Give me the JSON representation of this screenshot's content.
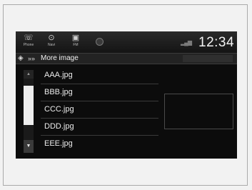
{
  "status_bar": {
    "icons": [
      {
        "icon": "phone-icon",
        "caption": "Phone"
      },
      {
        "icon": "navigation-icon",
        "caption": "Navi"
      },
      {
        "icon": "audio-icon",
        "caption": "FM"
      },
      {
        "icon": "home-icon",
        "caption": ""
      }
    ],
    "clock": "12:34"
  },
  "title_bar": {
    "icon": "media-icon",
    "chevrons": "»»",
    "title": "More image"
  },
  "file_list": {
    "items": [
      "AAA.jpg",
      "BBB.jpg",
      "CCC.jpg",
      "DDD.jpg",
      "EEE.jpg"
    ]
  },
  "colors": {
    "screen_bg": "#0c0c0c",
    "scroll_thumb": "#ededed",
    "text": "#ececec"
  }
}
